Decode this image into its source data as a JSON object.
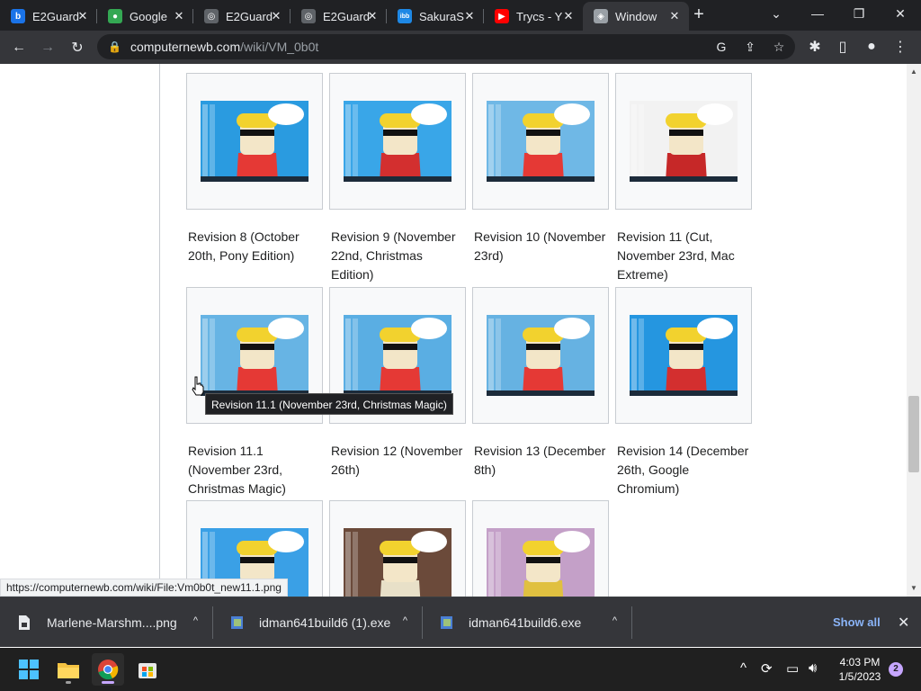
{
  "browser": {
    "tabs": [
      {
        "title": "E2Guard",
        "icon": "bing-icon",
        "color": "#1a73e8",
        "glyph": "b"
      },
      {
        "title": "Google",
        "icon": "maps-pin-icon",
        "color": "#34a853",
        "glyph": "●"
      },
      {
        "title": "E2Guard",
        "icon": "globe-icon",
        "color": "#5f6368",
        "glyph": "◎"
      },
      {
        "title": "E2Guard",
        "icon": "globe-icon",
        "color": "#5f6368",
        "glyph": "◎"
      },
      {
        "title": "SakuraS",
        "icon": "ibb-icon",
        "color": "#1e88e5",
        "glyph": "ibb"
      },
      {
        "title": "Trycs - Y",
        "icon": "youtube-icon",
        "color": "#ff0000",
        "glyph": "▶"
      },
      {
        "title": "Window",
        "icon": "wiki-icon",
        "color": "#9aa0a6",
        "glyph": "◈"
      }
    ],
    "address": {
      "host": "computernewb.com",
      "path": "/wiki/VM_0b0t"
    }
  },
  "gallery": {
    "items": [
      {
        "caption": "Revision 8 (October 20th, Pony Edition)",
        "bg": "#2a9be0",
        "accent": "#e53935"
      },
      {
        "caption": "Revision 9 (November 22nd, Christmas Edition)",
        "bg": "#39a6e8",
        "accent": "#d32f2f"
      },
      {
        "caption": "Revision 10 (November 23rd)",
        "bg": "#6fb8e6",
        "accent": "#e53935"
      },
      {
        "caption": "Revision 11 (Cut, November 23rd, Mac Extreme)",
        "bg": "#f2f2f2",
        "accent": "#c62828"
      },
      {
        "caption": "Revision 11.1 (November 23rd, Christmas Magic)",
        "bg": "#67b4e4",
        "accent": "#e53935"
      },
      {
        "caption": "Revision 12 (November 26th)",
        "bg": "#5aaee3",
        "accent": "#e53935"
      },
      {
        "caption": "Revision 13 (December 8th)",
        "bg": "#66b2e2",
        "accent": "#e53935"
      },
      {
        "caption": "Revision 14 (December 26th, Google Chromium)",
        "bg": "#2596e0",
        "accent": "#d32f2f"
      },
      {
        "caption": "",
        "bg": "#3aa0e6",
        "accent": "#d32f2f"
      },
      {
        "caption": "",
        "bg": "#6b4a3a",
        "accent": "#e8e0c8"
      },
      {
        "caption": "",
        "bg": "#c4a0c8",
        "accent": "#e0c040"
      }
    ]
  },
  "tooltip": "Revision 11.1 (November 23rd, Christmas Magic)",
  "status_url": "https://computernewb.com/wiki/File:Vm0b0t_new11.1.png",
  "downloads": {
    "items": [
      {
        "name": "Marlene-Marshm....png",
        "icon": "image-file-icon"
      },
      {
        "name": "idman641build6 (1).exe",
        "icon": "exe-file-icon"
      },
      {
        "name": "idman641build6.exe",
        "icon": "exe-file-icon"
      }
    ],
    "show_all": "Show all"
  },
  "taskbar": {
    "time": "4:03 PM",
    "date": "1/5/2023",
    "notifications": "2"
  }
}
